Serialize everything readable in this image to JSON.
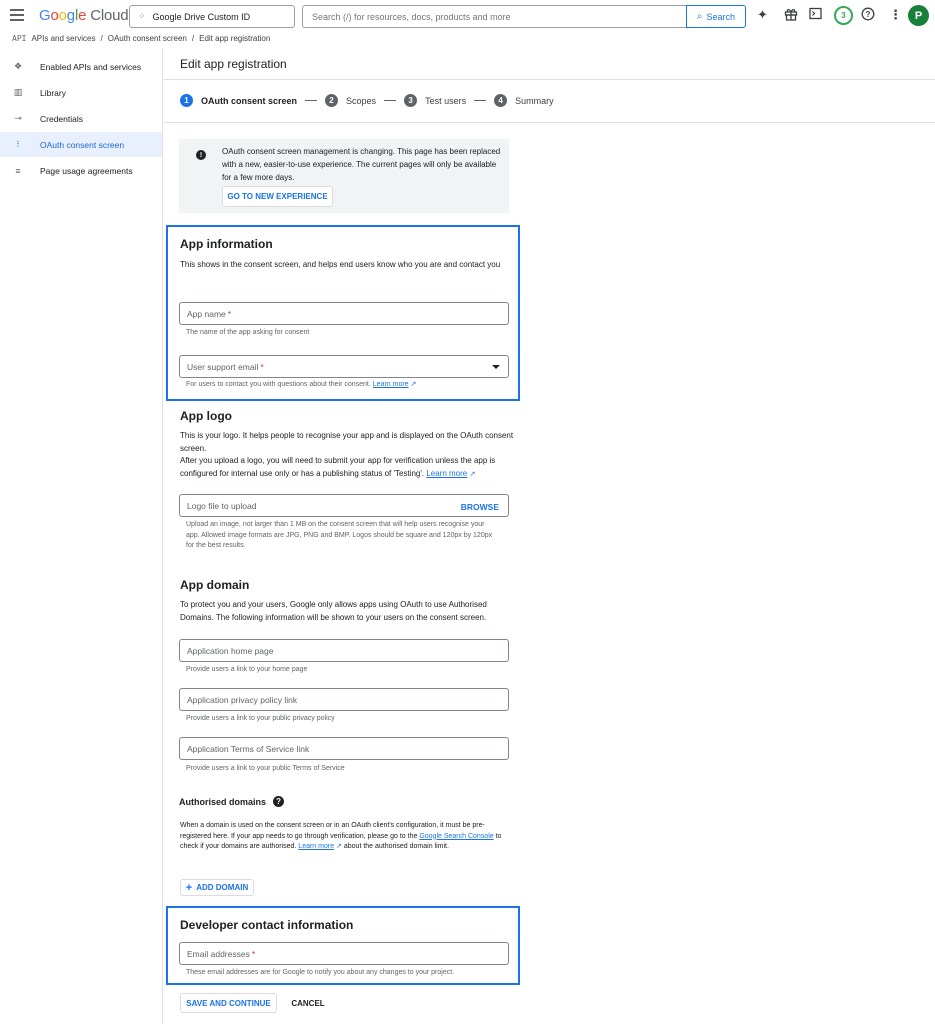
{
  "topbar": {
    "logo": {
      "g": "G",
      "o1": "o",
      "o2": "o",
      "g2": "g",
      "l": "l",
      "e": "e",
      "cloud": " Cloud"
    },
    "project": "Google Drive Custom ID",
    "search_placeholder": "Search (/) for resources, docs, products and more",
    "search_button": "Search",
    "notifications_count": "3",
    "avatar_letter": "P"
  },
  "breadcrumb": {
    "api_tag": "API",
    "items": [
      "APIs and services",
      "OAuth consent screen",
      "Edit app registration"
    ],
    "separator": "/"
  },
  "sidebar": {
    "items": [
      {
        "label": "Enabled APIs and services",
        "icon": "diamond-icon"
      },
      {
        "label": "Library",
        "icon": "library-icon"
      },
      {
        "label": "Credentials",
        "icon": "key-icon"
      },
      {
        "label": "OAuth consent screen",
        "icon": "consent-icon",
        "active": true
      },
      {
        "label": "Page usage agreements",
        "icon": "agreements-icon"
      }
    ]
  },
  "main": {
    "title": "Edit app registration",
    "steps": [
      {
        "num": "1",
        "label": "OAuth consent screen",
        "active": true
      },
      {
        "num": "2",
        "label": "Scopes"
      },
      {
        "num": "3",
        "label": "Test users"
      },
      {
        "num": "4",
        "label": "Summary"
      }
    ],
    "banner": {
      "text": "OAuth consent screen management is changing. This page has been replaced with a new, easier-to-use experience. The current pages will only be available for a few more days.",
      "button": "GO TO NEW EXPERIENCE"
    },
    "app_info": {
      "title": "App information",
      "desc": "This shows in the consent screen, and helps end users know who you are and contact you",
      "app_name_label": "App name",
      "app_name_hint": "The name of the app asking for consent",
      "email_label": "User support email",
      "email_hint": "For users to contact you with questions about their consent.",
      "learn_more": "Learn more"
    },
    "app_logo": {
      "title": "App logo",
      "desc1": "This is your logo. It helps people to recognise your app and is displayed on the OAuth consent screen.",
      "desc2": "After you upload a logo, you will need to submit your app for verification unless the app is configured for internal use only or has a publishing status of 'Testing'.",
      "learn_more": "Learn more",
      "field_label": "Logo file to upload",
      "browse": "BROWSE",
      "hint": "Upload an image, not larger than 1 MB on the consent screen that will help users recognise your app. Allowed image formats are JPG, PNG and BMP. Logos should be square and 120px by 120px for the best results."
    },
    "app_domain": {
      "title": "App domain",
      "desc": "To protect you and your users, Google only allows apps using OAuth to use Authorised Domains. The following information will be shown to your users on the consent screen.",
      "home_label": "Application home page",
      "home_hint": "Provide users a link to your home page",
      "privacy_label": "Application privacy policy link",
      "privacy_hint": "Provide users a link to your public privacy policy",
      "tos_label": "Application Terms of Service link",
      "tos_hint": "Provide users a link to your public Terms of Service"
    },
    "authorised_domains": {
      "title": "Authorised domains",
      "desc_a": "When a domain is used on the consent screen or in an OAuth client's configuration, it must be pre-registered here. If your app needs to go through verification, please go to the ",
      "console_link": "Google Search Console",
      "desc_b": " to check if your domains are authorised. ",
      "learn_more": "Learn more",
      "desc_c": " about the authorised domain limit.",
      "add_button": "ADD DOMAIN"
    },
    "developer_contact": {
      "title": "Developer contact information",
      "email_label": "Email addresses",
      "hint": "These email addresses are for Google to notify you about any changes to your project."
    },
    "actions": {
      "save": "SAVE AND CONTINUE",
      "cancel": "CANCEL"
    },
    "required_mark": "*"
  }
}
